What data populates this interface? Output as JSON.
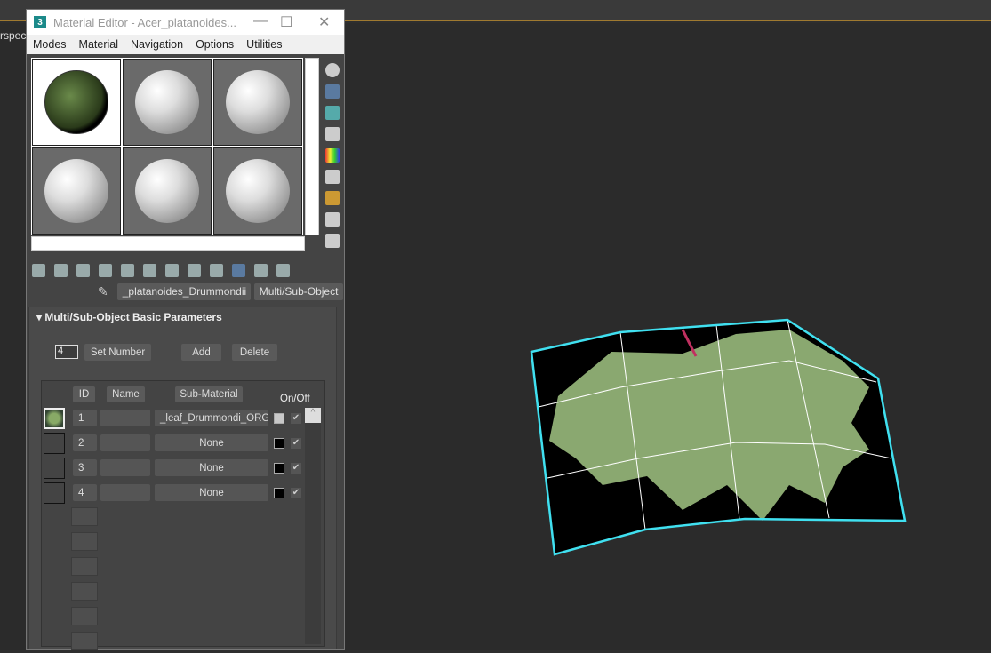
{
  "viewport": {
    "label": "rspect"
  },
  "window": {
    "title": "Material Editor - Acer_platanoides...",
    "logo": "3"
  },
  "menu": [
    "Modes",
    "Material",
    "Navigation",
    "Options",
    "Utilities"
  ],
  "material": {
    "name": "_platanoides_Drummondii",
    "type": "Multi/Sub-Object"
  },
  "rollout": {
    "title": "Multi/Sub-Object Basic Parameters",
    "count": "4",
    "set_number": "Set Number",
    "add": "Add",
    "delete": "Delete"
  },
  "table": {
    "headers": {
      "id": "ID",
      "name": "Name",
      "sub": "Sub-Material",
      "onoff": "On/Off"
    },
    "rows": [
      {
        "id": "1",
        "name": "",
        "sub": "_leaf_Drummondi_ORG ( S",
        "color": "#c8c8c8",
        "on": true
      },
      {
        "id": "2",
        "name": "",
        "sub": "None",
        "color": "#000000",
        "on": true
      },
      {
        "id": "3",
        "name": "",
        "sub": "None",
        "color": "#000000",
        "on": true
      },
      {
        "id": "4",
        "name": "",
        "sub": "None",
        "color": "#000000",
        "on": true
      }
    ]
  },
  "colors": {
    "accent": "#a07a30",
    "selection": "#40e0f0"
  }
}
